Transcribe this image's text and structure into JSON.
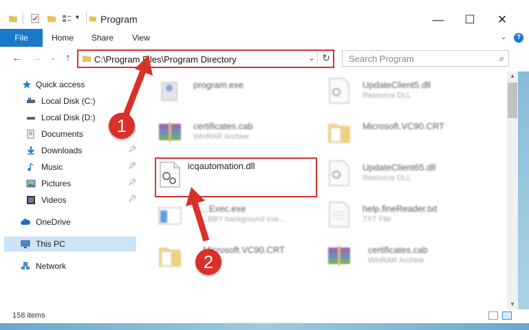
{
  "window": {
    "title": "Program",
    "controls": {
      "minimize": "—",
      "maximize": "☐",
      "close": "✕"
    }
  },
  "ribbon": {
    "tabs": [
      "File",
      "Home",
      "Share",
      "View"
    ],
    "help": "?"
  },
  "address": {
    "path": "C:\\Program Files\\Program Directory",
    "search_placeholder": "Search Program"
  },
  "nav": {
    "items": [
      {
        "label": "Quick access",
        "icon": "star-icon"
      },
      {
        "label": "Local Disk (C:)",
        "icon": "drive-icon"
      },
      {
        "label": "Local Disk (D:)",
        "icon": "drive-icon"
      },
      {
        "label": "Documents",
        "icon": "documents-icon",
        "pinned": true
      },
      {
        "label": "Downloads",
        "icon": "downloads-icon",
        "pinned": true
      },
      {
        "label": "Music",
        "icon": "music-icon",
        "pinned": true
      },
      {
        "label": "Pictures",
        "icon": "pictures-icon",
        "pinned": true
      },
      {
        "label": "Videos",
        "icon": "videos-icon",
        "pinned": true
      },
      {
        "label": "OneDrive",
        "icon": "cloud-icon"
      },
      {
        "label": "This PC",
        "icon": "pc-icon",
        "selected": true
      },
      {
        "label": "Network",
        "icon": "network-icon"
      }
    ]
  },
  "files": [
    {
      "name": "program.exe",
      "type": "",
      "icon": "exe-icon"
    },
    {
      "name": "UpdateClient5.dll",
      "type": "Resource DLL",
      "icon": "dll-icon"
    },
    {
      "name": "certificates.cab",
      "type": "WinRAR Archive",
      "icon": "archive-icon"
    },
    {
      "name": "Microsoft.VC90.CRT",
      "type": "",
      "icon": "folder-icon"
    },
    {
      "name": "icqautomation.dll",
      "type": "",
      "icon": "dll-icon"
    },
    {
      "name": "UpdateClient65.dll",
      "type": "Resource DLL",
      "icon": "dll-icon"
    },
    {
      "name": "...Exec.exe",
      "type": "...BBY background exe...",
      "icon": "exe-icon"
    },
    {
      "name": "help.fineReader.txt",
      "type": "TXT File",
      "icon": "txt-icon"
    },
    {
      "name": "Microsoft.VC90.CRT",
      "type": "",
      "icon": "folder-icon"
    },
    {
      "name": "certificates.cab",
      "type": "WinRAR Archive",
      "icon": "archive-icon"
    }
  ],
  "status": {
    "count": "158 items"
  },
  "annotations": {
    "step1": "1",
    "step2": "2"
  },
  "colors": {
    "accent": "#1979ca",
    "highlight": "#d9302a",
    "selection": "#cce4f7"
  }
}
